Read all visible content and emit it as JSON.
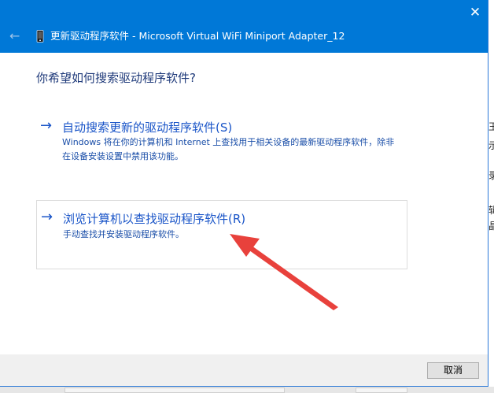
{
  "window": {
    "title": "更新驱动程序软件 - Microsoft Virtual WiFi Miniport Adapter_12",
    "close_glyph": "✕",
    "back_glyph": "←"
  },
  "dialog": {
    "question": "你希望如何搜索驱动程序软件?",
    "options": [
      {
        "arrow": "→",
        "title": "自动搜索更新的驱动程序软件(S)",
        "description": "Windows 将在你的计算机和 Internet 上查找用于相关设备的最新驱动程序软件，除非在设备安装设置中禁用该功能。"
      },
      {
        "arrow": "→",
        "title": "浏览计算机以查找驱动程序软件(R)",
        "description": "手动查找并安装驱动程序软件。"
      }
    ],
    "cancel_label": "取消"
  },
  "background_window": {
    "glyphs": [
      "王",
      "示",
      "录",
      "辑",
      "晶"
    ]
  },
  "colors": {
    "titlebar": "#0078d7",
    "link": "#1a55c8",
    "annotation_arrow": "#e8413c"
  },
  "icons": {
    "close": "close-icon",
    "back": "back-arrow-icon",
    "app": "device-icon",
    "option_arrow": "arrow-right-icon",
    "annotation": "red-pointer-arrow"
  }
}
